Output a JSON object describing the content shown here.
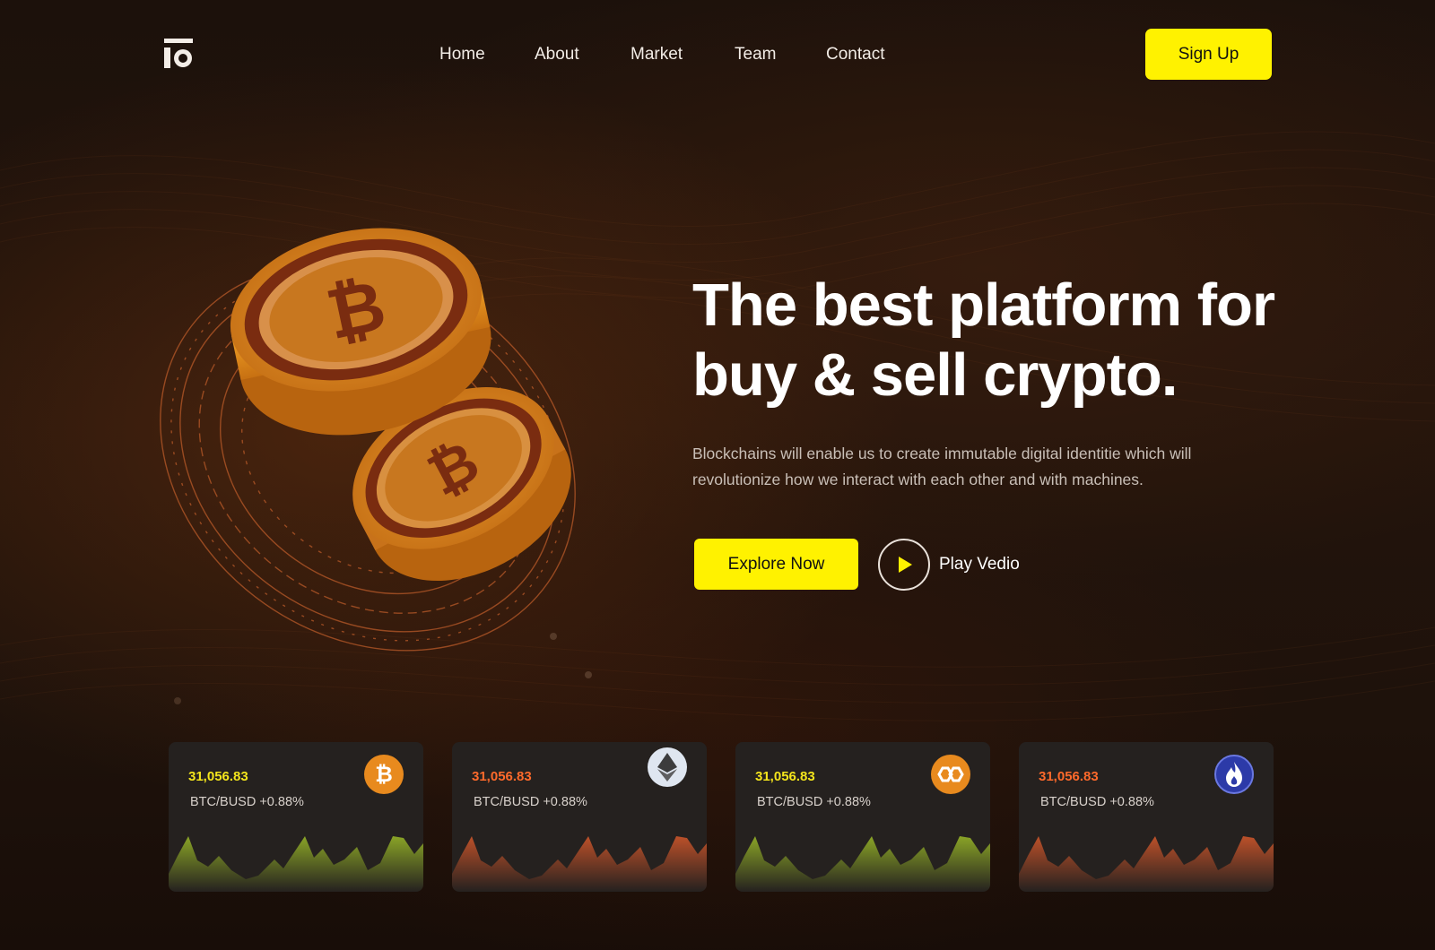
{
  "header": {
    "logo_icon": "brand-logo-icon",
    "nav": [
      "Home",
      "About",
      "Market",
      "Team",
      "Contact"
    ],
    "signup_label": "Sign Up"
  },
  "hero": {
    "title_line1": "The best platform for",
    "title_line2": "buy & sell crypto.",
    "description_line1": "Blockchains will enable us to create immutable digital identitie which will",
    "description_line2": "revolutionize how we interact with each other and with machines.",
    "explore_label": "Explore Now",
    "play_label": "Play Vedio",
    "illustration": "bitcoin-coins-icon"
  },
  "tickers": [
    {
      "price": "31,056.83",
      "pair": "BTC/BUSD +0.88%",
      "icon": "bitcoin-icon",
      "accent": "#f4e51c",
      "chart": "#9db52a",
      "icon_bg": "#e88a1e"
    },
    {
      "price": "31,056.83",
      "pair": "BTC/BUSD +0.88%",
      "icon": "ethereum-icon",
      "accent": "#ff6a2b",
      "chart": "#c9542a",
      "icon_bg": "#dfe6f0"
    },
    {
      "price": "31,056.83",
      "pair": "BTC/BUSD +0.88%",
      "icon": "polygon-icon",
      "accent": "#f4e51c",
      "chart": "#9db52a",
      "icon_bg": "#e88a1e"
    },
    {
      "price": "31,056.83",
      "pair": "BTC/BUSD +0.88%",
      "icon": "huobi-token-icon",
      "accent": "#ff6a2b",
      "chart": "#c9542a",
      "icon_bg": "#2c3aa8"
    }
  ],
  "colors": {
    "accent_yellow": "#fff200",
    "background": "#1a0f0a",
    "card": "#25211f"
  }
}
